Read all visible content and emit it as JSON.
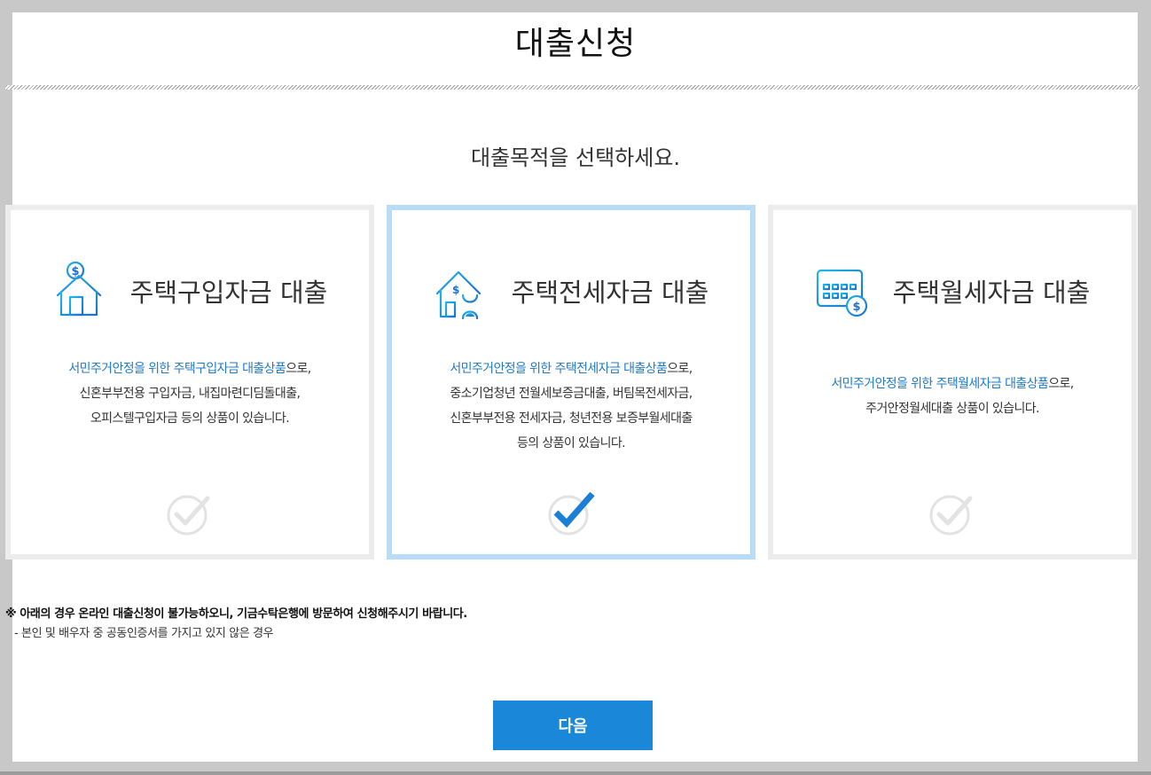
{
  "header": {
    "title": "대출신청"
  },
  "main": {
    "subtitle": "대출목적을 선택하세요."
  },
  "cards": [
    {
      "title": "주택구입자금 대출",
      "icon": "house-dollar-icon",
      "selected": false,
      "desc": {
        "highlight": "서민주거안정을 위한 주택구입자금 대출상품",
        "rest": "으로,",
        "lines": [
          "신혼부부전용 구입자금, 내집마련디딤돌대출,",
          "오피스텔구입자금 등의 상품이 있습니다."
        ]
      }
    },
    {
      "title": "주택전세자금 대출",
      "icon": "house-hourglass-icon",
      "selected": true,
      "desc": {
        "highlight": "서민주거안정을 위한 주택전세자금 대출상품",
        "rest": "으로,",
        "lines": [
          "중소기업청년 전월세보증금대출, 버팀목전세자금,",
          "신혼부부전용 전세자금, 청년전용 보증부월세대출",
          "등의 상품이 있습니다."
        ]
      }
    },
    {
      "title": "주택월세자금 대출",
      "icon": "calendar-dollar-icon",
      "selected": false,
      "desc": {
        "highlight": "서민주거안정을 위한 주택월세자금 대출상품",
        "rest": "으로,",
        "lines": [
          "주거안정월세대출 상품이 있습니다."
        ]
      }
    }
  ],
  "notice": {
    "main": "※ 아래의 경우 온라인 대출신청이 불가능하오니, 기금수탁은행에 방문하여 신청해주시기 바랍니다.",
    "item": "- 본인 및 배우자 중 공동인증서를 가지고 있지 않은 경우"
  },
  "actions": {
    "next_label": "다음"
  },
  "colors": {
    "accent": "#1a87d9",
    "highlight_text": "#1f7acb",
    "selected_border": "#b8dcf5",
    "card_border": "#ececec",
    "icon_gradient_start": "#1fb6e8",
    "icon_gradient_end": "#1e6fd0"
  }
}
